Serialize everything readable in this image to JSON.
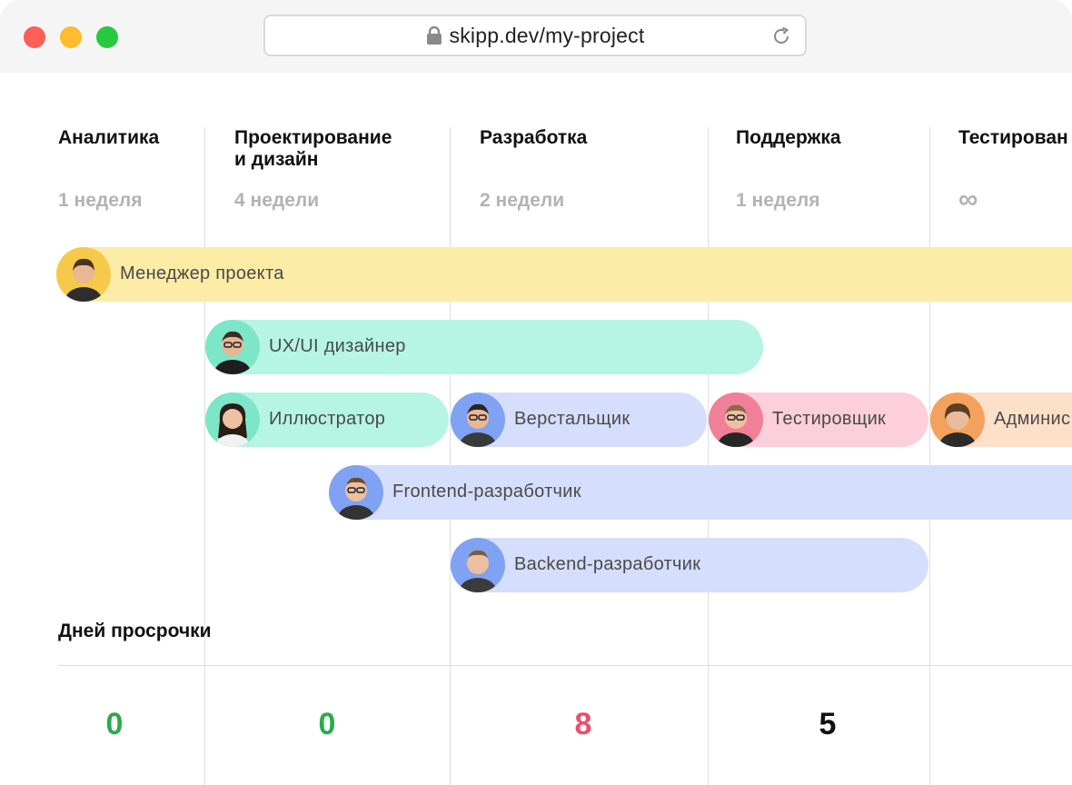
{
  "browser": {
    "url": "skipp.dev/my-project",
    "icons": [
      "lock-icon",
      "reload-icon"
    ]
  },
  "phases": [
    {
      "title": "Аналитика",
      "duration": "1 неделя"
    },
    {
      "title": "Проектирование\nи дизайн",
      "duration": "4 недели"
    },
    {
      "title": "Разработка",
      "duration": "2 недели"
    },
    {
      "title": "Поддержка",
      "duration": "1 неделя"
    },
    {
      "title": "Тестирован",
      "duration": "∞"
    }
  ],
  "roles": [
    {
      "label": "Менеджер проекта",
      "color": "#fdeca6",
      "avatar_bg": "#f5c94a"
    },
    {
      "label": "UX/UI дизайнер",
      "color": "#b6f5e3",
      "avatar_bg": "#7ee6c8"
    },
    {
      "label": "Иллюстратор",
      "color": "#b6f5e3",
      "avatar_bg": "#7ee6c8"
    },
    {
      "label": "Верстальщик",
      "color": "#d6defd",
      "avatar_bg": "#7fa2f2"
    },
    {
      "label": "Тестировщик",
      "color": "#fccfda",
      "avatar_bg": "#f07f98"
    },
    {
      "label": "Админис",
      "color": "#fde0c8",
      "avatar_bg": "#f5a15e"
    },
    {
      "label": "Frontend-разработчик",
      "color": "#d6defd",
      "avatar_bg": "#7fa2f2"
    },
    {
      "label": "Backend-разработчик",
      "color": "#d6defd",
      "avatar_bg": "#7fa2f2"
    }
  ],
  "delays": {
    "title": "Дней просрочки",
    "values": [
      {
        "value": "0",
        "color": "#2fa84f"
      },
      {
        "value": "0",
        "color": "#2fa84f"
      },
      {
        "value": "8",
        "color": "#e94f6a"
      },
      {
        "value": "5",
        "color": "#111111"
      }
    ]
  }
}
